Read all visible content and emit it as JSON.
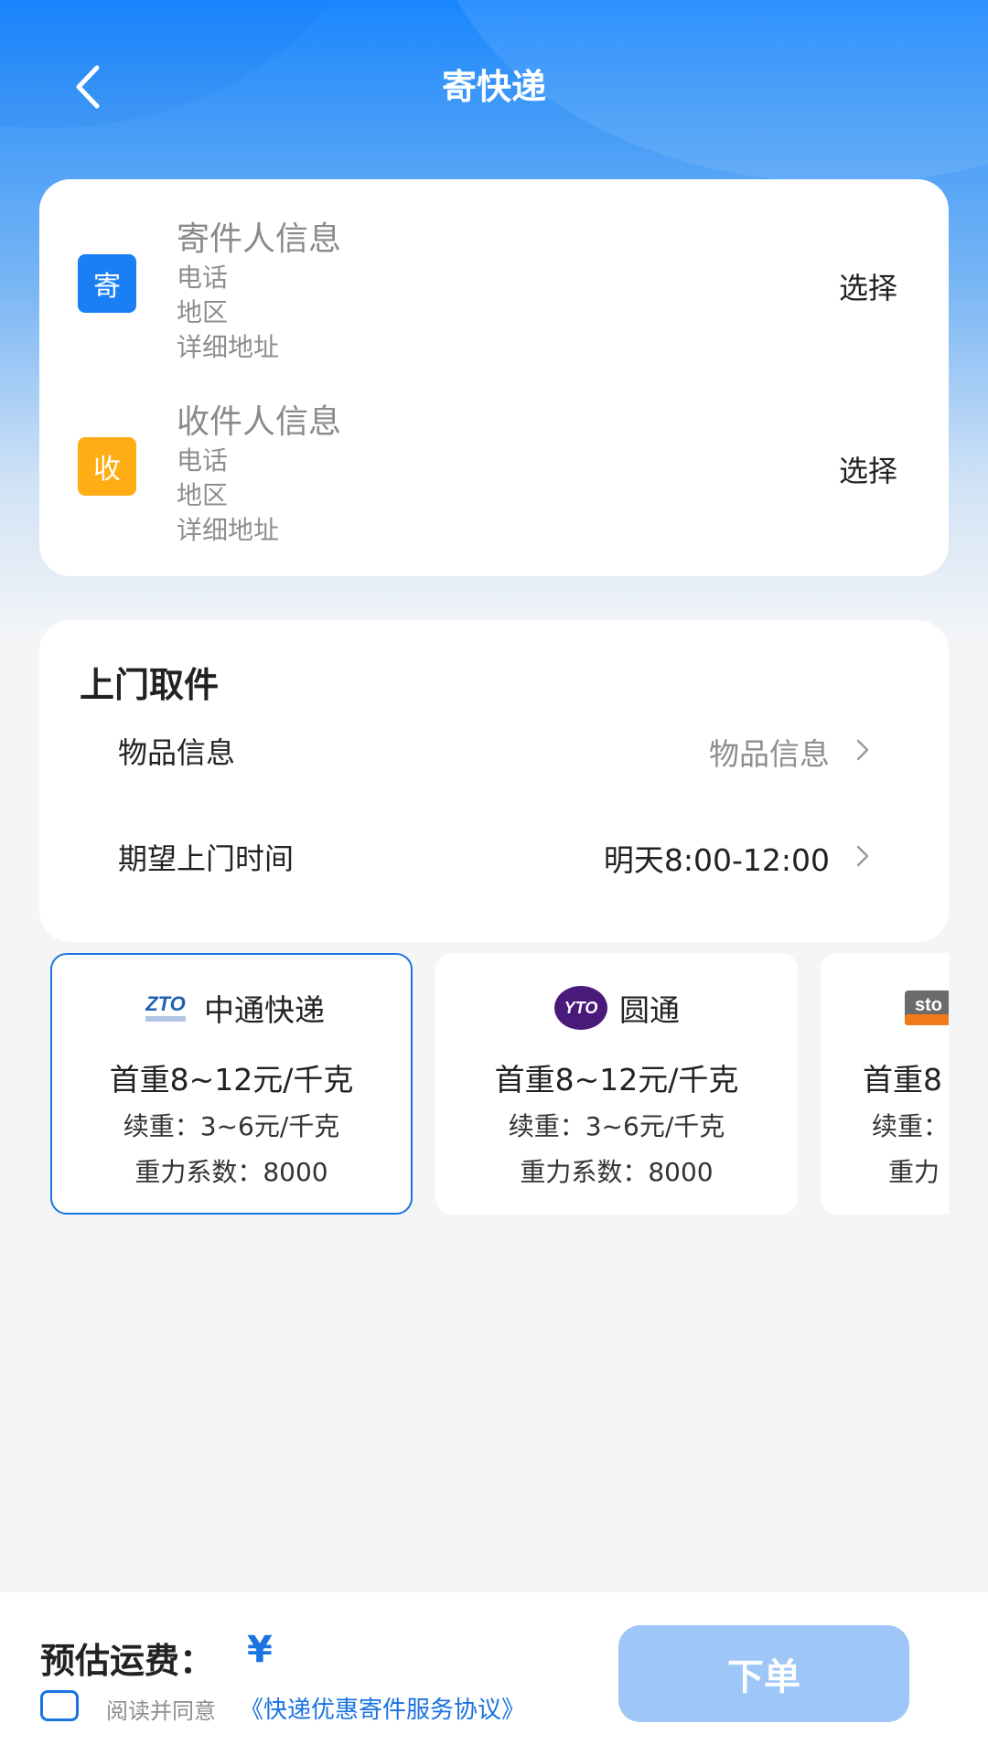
{
  "header": {
    "title": "寄快递"
  },
  "sender": {
    "badge": "寄",
    "title": "寄件人信息",
    "phone_label": "电话",
    "region_label": "地区",
    "address_label": "详细地址",
    "action": "选择",
    "badge_color": "#1a7ff5"
  },
  "receiver": {
    "badge": "收",
    "title": "收件人信息",
    "phone_label": "电话",
    "region_label": "地区",
    "address_label": "详细地址",
    "action": "选择",
    "badge_color": "#ffad14"
  },
  "pickup": {
    "title": "上门取件",
    "item_label": "物品信息",
    "item_value": "物品信息",
    "time_label": "期望上门时间",
    "time_value": "明天8:00-12:00"
  },
  "carriers": [
    {
      "name": "中通快递",
      "logo_icon": "zto-logo-icon",
      "first_weight": "首重8~12元/千克",
      "extra_weight": "续重：3~6元/千克",
      "coefficient": "重力系数：8000",
      "selected": true
    },
    {
      "name": "圆通",
      "logo_icon": "yto-logo-icon",
      "first_weight": "首重8~12元/千克",
      "extra_weight": "续重：3~6元/千克",
      "coefficient": "重力系数：8000",
      "selected": false
    },
    {
      "name": "",
      "logo_icon": "sto-logo-icon",
      "first_weight": "首重8",
      "extra_weight": "续重：",
      "coefficient": "重力",
      "selected": false
    }
  ],
  "footer": {
    "fee_label": "预估运费：",
    "fee_value": "¥",
    "agree_text": "阅读并同意",
    "agree_link": "《快递优惠寄件服务协议》",
    "order_button": "下单"
  },
  "colors": {
    "accent": "#1a73e0",
    "order_button_disabled": "#9ec7f7"
  }
}
